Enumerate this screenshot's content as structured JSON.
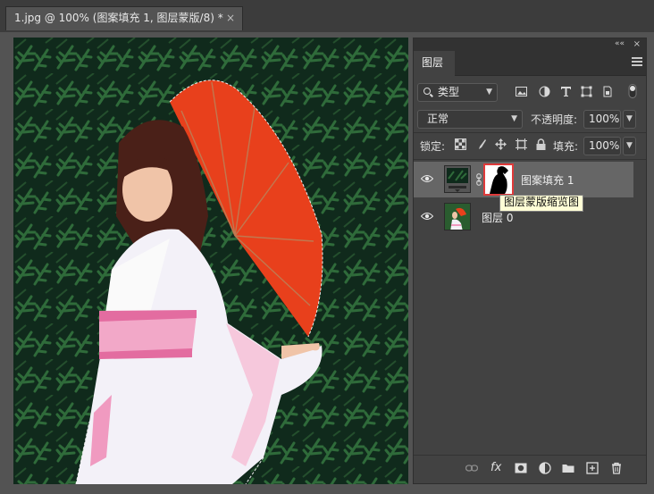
{
  "document": {
    "tab_title": "1.jpg @ 100% (图案填充 1, 图层蒙版/8) *",
    "close_glyph": "×"
  },
  "layers_panel": {
    "collapse_glyph": "««",
    "close_glyph": "×",
    "tab_label": "图层",
    "filter": {
      "selected": "类型",
      "icons": [
        "image-filter-icon",
        "adjustment-filter-icon",
        "type-filter-icon",
        "shape-filter-icon",
        "smart-object-filter-icon",
        "filter-toggle-icon"
      ]
    },
    "blend_mode": "正常",
    "opacity_label": "不透明度:",
    "opacity_value": "100%",
    "lock_label": "锁定:",
    "lock_icons": [
      "lock-transparent-icon",
      "lock-image-icon",
      "lock-position-icon",
      "lock-artboard-icon",
      "lock-all-icon"
    ],
    "fill_label": "填充:",
    "fill_value": "100%",
    "layers": [
      {
        "name": "图案填充 1",
        "selected": true,
        "visible": true,
        "has_mask": true
      },
      {
        "name": "图层 0",
        "selected": false,
        "visible": true,
        "has_mask": false
      }
    ],
    "tooltip": "图层蒙版缩览图",
    "footer_icons": [
      "link-layers-icon",
      "fx-icon",
      "add-mask-icon",
      "adjustment-layer-icon",
      "new-group-icon",
      "new-layer-icon",
      "delete-layer-icon"
    ],
    "fx_label": "fx"
  },
  "colors": {
    "umbrella": "#e8401c",
    "mask_highlight": "#e03a3a",
    "selected_row": "#666666"
  }
}
